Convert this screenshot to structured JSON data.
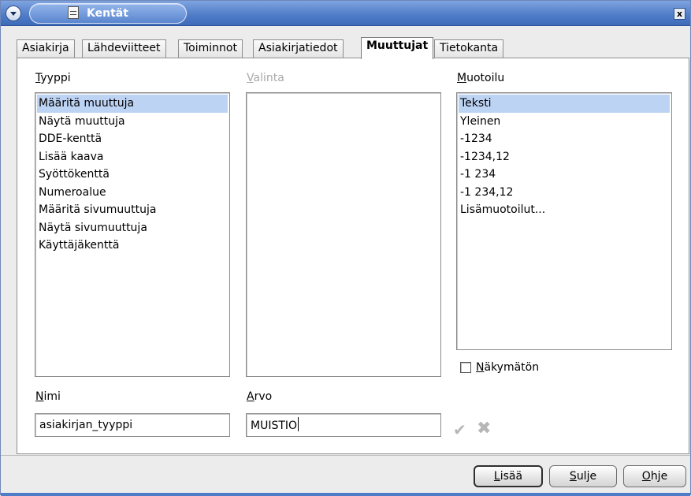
{
  "window": {
    "title": "Kentät",
    "close_label": "x"
  },
  "tabs": [
    {
      "label": "Asiakirja",
      "active": false
    },
    {
      "label": "Lähdeviitteet",
      "active": false
    },
    {
      "label": "Toiminnot",
      "active": false
    },
    {
      "label": "Asiakirjatiedot",
      "active": false
    },
    {
      "label": "Muuttujat",
      "active": true
    },
    {
      "label": "Tietokanta",
      "active": false
    }
  ],
  "type_section": {
    "label_mnemonic": "T",
    "label_rest": "yyppi",
    "items": [
      "Määritä muuttuja",
      "Näytä muuttuja",
      "DDE-kenttä",
      "Lisää kaava",
      "Syöttökenttä",
      "Numeroalue",
      "Määritä sivumuuttuja",
      "Näytä sivumuuttuja",
      "Käyttäjäkenttä"
    ],
    "selected_index": 0
  },
  "selection_section": {
    "label_mnemonic": "V",
    "label_rest": "alinta",
    "disabled": true
  },
  "format_section": {
    "label_mnemonic": "M",
    "label_rest": "uotoilu",
    "items": [
      "Teksti",
      "Yleinen",
      "-1234",
      "-1234,12",
      "-1 234",
      "-1 234,12",
      "Lisämuotoilut..."
    ],
    "selected_index": 0
  },
  "invisible_checkbox": {
    "label_mnemonic": "N",
    "label_rest": "äkymätön",
    "checked": false
  },
  "name_field": {
    "label_mnemonic": "N",
    "label_rest": "imi",
    "value": "asiakirjan_tyyppi"
  },
  "value_field": {
    "label_mnemonic": "A",
    "label_rest": "rvo",
    "value": "MUISTIO"
  },
  "icons": {
    "apply": "checkmark-icon",
    "delete": "cross-icon",
    "apply_glyph": "✔",
    "delete_glyph": "✖"
  },
  "buttons": {
    "add": {
      "mnemonic": "L",
      "rest": "isää"
    },
    "close": {
      "mnemonic": "S",
      "rest": "ulje"
    },
    "help": {
      "mnemonic": "O",
      "rest": "hje"
    }
  },
  "colors": {
    "titlebar": "#4f7cc7",
    "selection": "#bdd3f4",
    "disabled_text": "#a9a9a9"
  }
}
